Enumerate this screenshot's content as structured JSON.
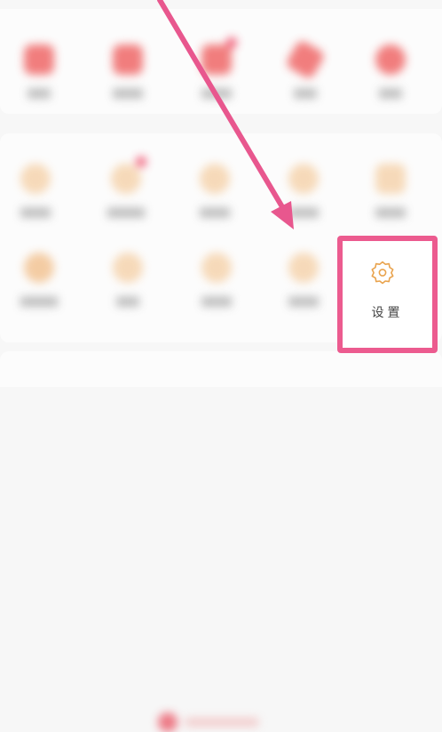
{
  "settings": {
    "label": "设置",
    "icon": "gear-icon",
    "highlight_color": "#ec5b8f"
  },
  "annotation": {
    "arrow_color": "#e8578e"
  },
  "blurred_icons": {
    "row1": [
      "red-square-icon",
      "red-square-icon",
      "red-square-badge-icon",
      "red-diamond-icon",
      "red-circle-icon"
    ],
    "row2": [
      "orange-circle-icon",
      "orange-circle-badge-icon",
      "orange-circle-icon",
      "orange-magnifier-icon",
      "orange-square-icon"
    ],
    "row3": [
      "orange-circle-icon",
      "orange-circle-icon",
      "orange-circle-icon",
      "orange-circle-icon"
    ]
  }
}
